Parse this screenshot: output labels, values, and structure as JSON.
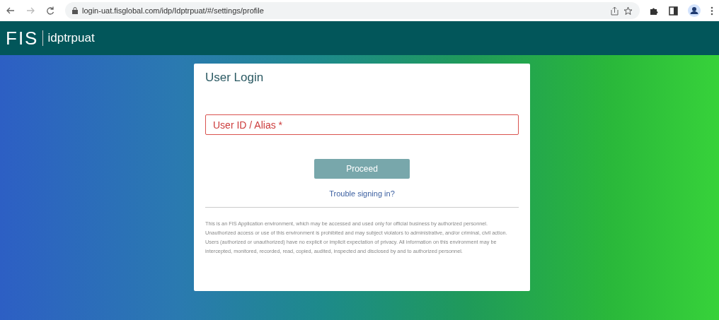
{
  "browser": {
    "url": "login-uat.fisglobal.com/idp/Idptrpuat/#/settings/profile"
  },
  "header": {
    "logo": "FIS",
    "app_name": "idptrpuat"
  },
  "login": {
    "title": "User Login",
    "field": {
      "placeholder": "User ID / Alias *",
      "invalid": true
    },
    "proceed": {
      "label": "Proceed",
      "disabled": true
    },
    "help_link": "Trouble signing in?",
    "disclaimer": "This is an FIS Application environment, which may be accessed and used only for official business by authorized personnel. Unauthorized access or use of this environment is prohibited and may subject violators to administrative, and/or criminal, civil action. Users (authorized or unauthorized) have no explicit or implicit expectation of privacy. All information on this environment may be intercepted, monitored, recorded, read, copied, audited, inspected and disclosed by and to authorized personnel."
  }
}
